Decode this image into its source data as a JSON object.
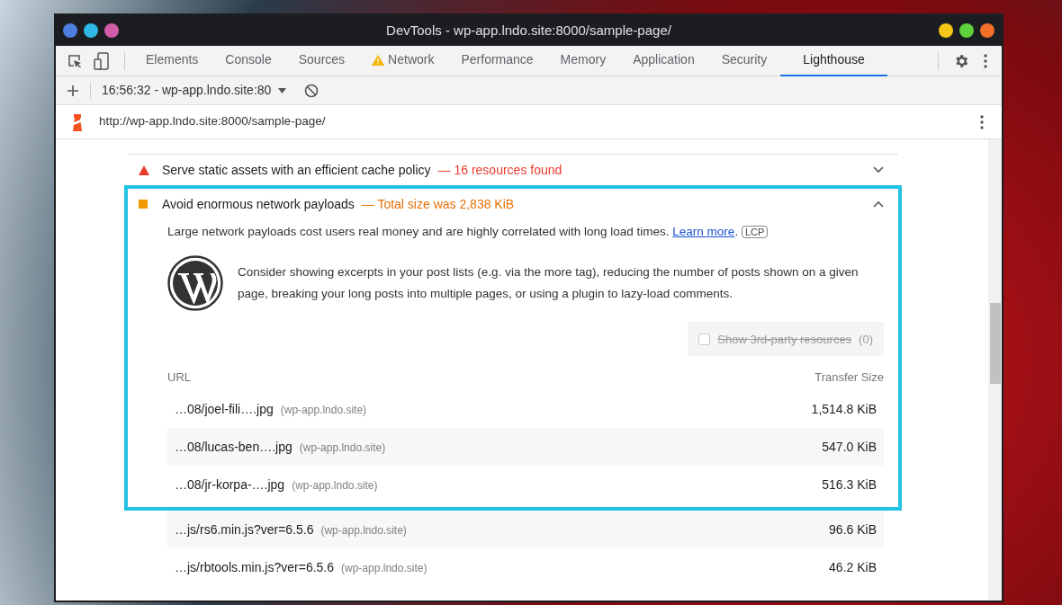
{
  "window": {
    "title": "DevTools - wp-app.lndo.site:8000/sample-page/"
  },
  "tabs": [
    {
      "label": "Elements",
      "selected": false,
      "warning": false
    },
    {
      "label": "Console",
      "selected": false,
      "warning": false
    },
    {
      "label": "Sources",
      "selected": false,
      "warning": false
    },
    {
      "label": "Network",
      "selected": false,
      "warning": true
    },
    {
      "label": "Performance",
      "selected": false,
      "warning": false
    },
    {
      "label": "Memory",
      "selected": false,
      "warning": false
    },
    {
      "label": "Application",
      "selected": false,
      "warning": false
    },
    {
      "label": "Security",
      "selected": false,
      "warning": false
    },
    {
      "label": "Lighthouse",
      "selected": true,
      "warning": false
    }
  ],
  "toolbar": {
    "report_select": "16:56:32 - wp-app.lndo.site:80"
  },
  "url_bar": {
    "url": "http://wp-app.lndo.site:8000/sample-page/"
  },
  "audits": [
    {
      "kind": "fail",
      "title": "Serve static assets with an efficient cache policy",
      "display_value": "— 16 resources found",
      "expanded": false,
      "highlighted": false
    },
    {
      "kind": "average",
      "title": "Avoid enormous network payloads",
      "display_value": "— Total size was 2,838 KiB",
      "expanded": true,
      "highlighted": true,
      "description": "Large network payloads cost users real money and are highly correlated with long load times.",
      "link": "Learn more",
      "after_link": ".",
      "badge": "LCP",
      "stack_pack": "Consider showing excerpts in your post lists (e.g. via the more tag), reducing the number of posts shown on a given page, breaking your long posts into multiple pages, or using a plugin to lazy-load comments.",
      "third_party": {
        "label": "Show 3rd-party resources",
        "count": "(0)",
        "checked": false,
        "disabled": true
      },
      "columns": [
        "URL",
        "Transfer Size"
      ],
      "rows": [
        {
          "url": "…08/joel-fili….jpg",
          "host": "(wp-app.lndo.site)",
          "size": "1,514.8 KiB",
          "in_highlight": true
        },
        {
          "url": "…08/lucas-ben….jpg",
          "host": "(wp-app.lndo.site)",
          "size": "547.0 KiB",
          "in_highlight": true
        },
        {
          "url": "…08/jr-korpa-….jpg",
          "host": "(wp-app.lndo.site)",
          "size": "516.3 KiB",
          "in_highlight": true
        },
        {
          "url": "…js/rs6.min.js?ver=6.5.6",
          "host": "(wp-app.lndo.site)",
          "size": "96.6 KiB",
          "in_highlight": false
        },
        {
          "url": "…js/rbtools.min.js?ver=6.5.6",
          "host": "(wp-app.lndo.site)",
          "size": "46.2 KiB",
          "in_highlight": false
        }
      ]
    }
  ]
}
